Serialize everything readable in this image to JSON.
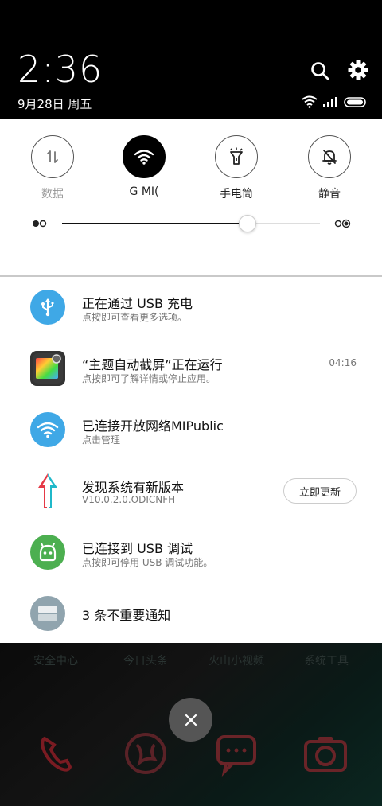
{
  "status": {
    "time": "2:36",
    "date": "9月28日 周五"
  },
  "quick_settings": {
    "toggles": [
      {
        "label": "数据",
        "state": "off"
      },
      {
        "label": "G   MI(",
        "state": "on"
      },
      {
        "label": "手电筒",
        "state": "off"
      },
      {
        "label": "静音",
        "state": "off"
      }
    ],
    "brightness_fraction": 0.72
  },
  "notifications": [
    {
      "title": "正在通过 USB 充电",
      "subtitle": "点按即可查看更多选项。",
      "icon": "usb-icon",
      "color": "#3fa8e6"
    },
    {
      "title": "“主题自动截屏”正在运行",
      "subtitle": "点按即可了解详情或停止应用。",
      "time": "04:16",
      "icon": "screenshot-app-icon"
    },
    {
      "title": "已连接开放网络MIPublic",
      "subtitle": "点击管理",
      "icon": "wifi-icon",
      "color": "#3fa8e6"
    },
    {
      "title": "发现系统有新版本",
      "subtitle": "V10.0.2.0.ODICNFH",
      "icon": "update-arrow-icon",
      "action": "立即更新"
    },
    {
      "title": "已连接到 USB 调试",
      "subtitle": "点按即可停用 USB 调试功能。",
      "icon": "android-icon",
      "color": "#4caf50"
    },
    {
      "title": "3 条不重要通知",
      "icon": "folded-notifications-icon",
      "color": "#90a4ae"
    }
  ],
  "home": {
    "apps": [
      "安全中心",
      "今日头条",
      "火山小视频",
      "系统工具"
    ]
  }
}
